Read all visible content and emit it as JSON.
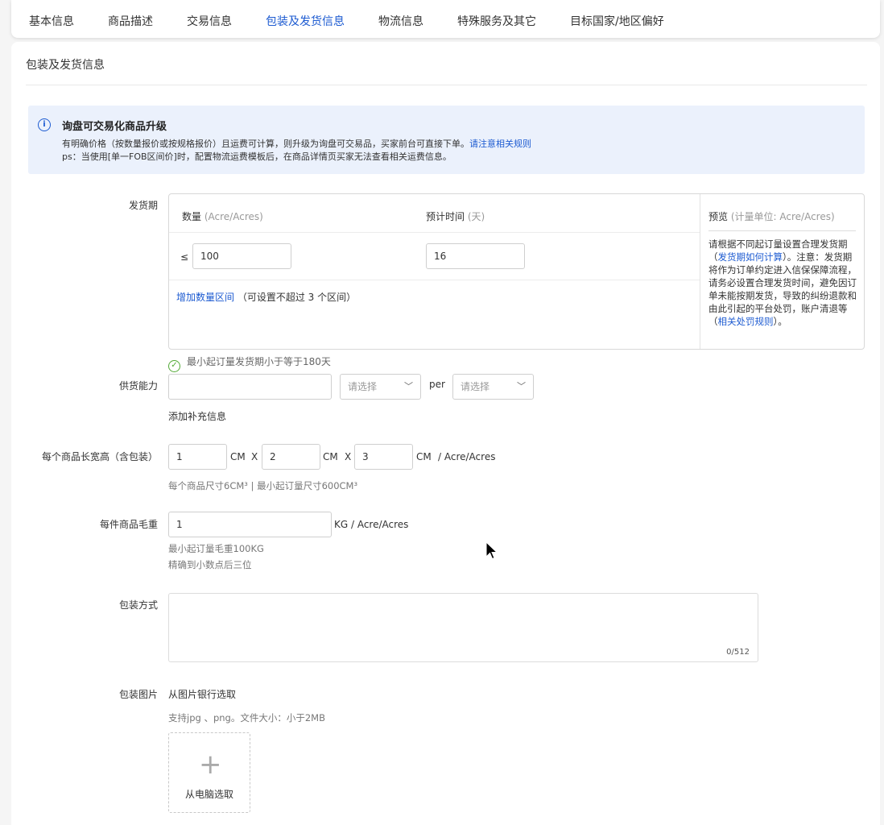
{
  "tabs": [
    {
      "label": "基本信息",
      "active": false
    },
    {
      "label": "商品描述",
      "active": false
    },
    {
      "label": "交易信息",
      "active": false
    },
    {
      "label": "包装及发货信息",
      "active": true
    },
    {
      "label": "物流信息",
      "active": false
    },
    {
      "label": "特殊服务及其它",
      "active": false
    },
    {
      "label": "目标国家/地区偏好",
      "active": false
    }
  ],
  "section_title": "包装及发货信息",
  "notice": {
    "icon": "info-icon",
    "title": "询盘可交易化商品升级",
    "line1": "有明确价格（按数量报价或按规格报价）且运费可计算，则升级为询盘可交易品，买家前台可直接下单。",
    "line1_link": "请注意相关规则",
    "line2": "ps：当使用[单一FOB区间价]时，配置物流运费模板后，在商品详情页买家无法查看相关运费信息。"
  },
  "delivery": {
    "label": "发货期",
    "qty_header": "数量",
    "qty_unit": "(Acre/Acres)",
    "time_header": "预计时间",
    "time_unit": "(天)",
    "lte_symbol": "≤",
    "qty_value": "100",
    "days_value": "16",
    "add_range_link": "增加数量区间",
    "add_range_note": "（可设置不超过 3 个区间）",
    "preview_title": "预览",
    "preview_unit": "(计量单位: Acre/Acres)",
    "preview_text_1": "请根据不同起订量设置合理发货期（",
    "preview_link_1": "发货期如何计算",
    "preview_text_2": "）。注意：发货期将作为订单约定进入信保保障流程，请务必设置合理发货时间，避免因订单未能按期发货，导致的纠纷退款和由此引起的平台处罚，账户清退等（",
    "preview_link_2": "相关处罚规则",
    "preview_text_3": "）。",
    "validation_icon": "check-circle-icon",
    "validation": "最小起订量发货期小于等于180天"
  },
  "supply": {
    "label": "供货能力",
    "input_value": "",
    "select1_placeholder": "请选择",
    "per": "per",
    "select2_placeholder": "请选择",
    "add_info_link": "添加补充信息"
  },
  "dimensions": {
    "label": "每个商品长宽高（含包装）",
    "length": "1",
    "width": "2",
    "height": "3",
    "unit": "CM",
    "times": "X",
    "per_unit": "/ Acre/Acres",
    "hint": "每个商品尺寸6CM³ | 最小起订量尺寸600CM³"
  },
  "weight": {
    "label": "每件商品毛重",
    "value": "1",
    "unit": "KG / Acre/Acres",
    "hint1": "最小起订量毛重100KG",
    "hint2": "精确到小数点后三位"
  },
  "packing": {
    "label": "包装方式",
    "value": "",
    "counter": "0/512"
  },
  "images": {
    "label": "包装图片",
    "bank_link": "从图片银行选取",
    "hint": "支持jpg 、png。文件大小：小于2MB",
    "upload_icon": "plus-icon",
    "upload_label": "从电脑选取"
  }
}
